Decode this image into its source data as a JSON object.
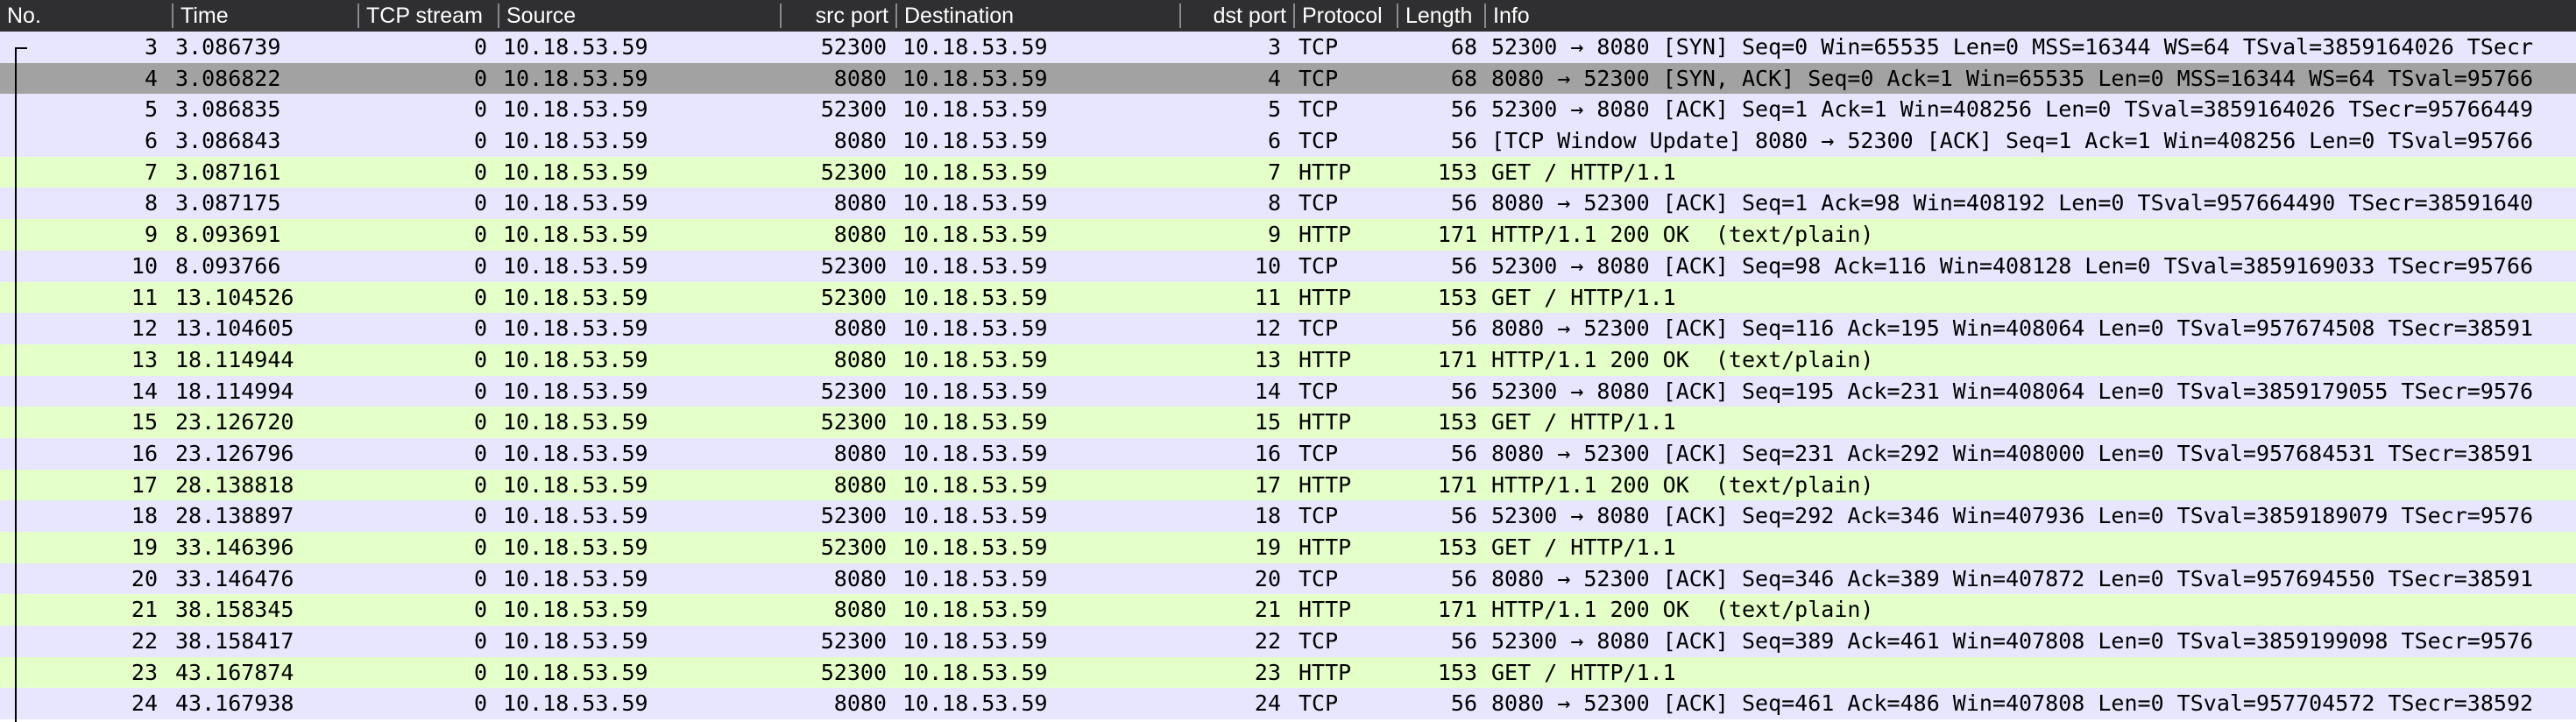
{
  "columns": {
    "no": "No.",
    "time": "Time",
    "tcp_stream": "TCP stream",
    "source": "Source",
    "src_port": "src port",
    "destination": "Destination",
    "dst_port": "dst port",
    "protocol": "Protocol",
    "length": "Length",
    "info": "Info"
  },
  "colors": {
    "header_bg": "#2f2f31",
    "tcp_row": "#e7e6fe",
    "http_row": "#e4ffc7",
    "selected_row": "#a2a2a2"
  },
  "selected_packet": "4",
  "packets": [
    {
      "no": "3",
      "time": "3.086739",
      "stream": "0",
      "src": "10.18.53.59",
      "sport": "52300",
      "dst": "10.18.53.59",
      "dport": "3",
      "proto": "TCP",
      "len": "68",
      "info": "52300 → 8080 [SYN] Seq=0 Win=65535 Len=0 MSS=16344 WS=64 TSval=3859164026 TSecr"
    },
    {
      "no": "4",
      "time": "3.086822",
      "stream": "0",
      "src": "10.18.53.59",
      "sport": "8080",
      "dst": "10.18.53.59",
      "dport": "4",
      "proto": "TCP",
      "len": "68",
      "info": "8080 → 52300 [SYN, ACK] Seq=0 Ack=1 Win=65535 Len=0 MSS=16344 WS=64 TSval=95766"
    },
    {
      "no": "5",
      "time": "3.086835",
      "stream": "0",
      "src": "10.18.53.59",
      "sport": "52300",
      "dst": "10.18.53.59",
      "dport": "5",
      "proto": "TCP",
      "len": "56",
      "info": "52300 → 8080 [ACK] Seq=1 Ack=1 Win=408256 Len=0 TSval=3859164026 TSecr=95766449"
    },
    {
      "no": "6",
      "time": "3.086843",
      "stream": "0",
      "src": "10.18.53.59",
      "sport": "8080",
      "dst": "10.18.53.59",
      "dport": "6",
      "proto": "TCP",
      "len": "56",
      "info": "[TCP Window Update] 8080 → 52300 [ACK] Seq=1 Ack=1 Win=408256 Len=0 TSval=95766"
    },
    {
      "no": "7",
      "time": "3.087161",
      "stream": "0",
      "src": "10.18.53.59",
      "sport": "52300",
      "dst": "10.18.53.59",
      "dport": "7",
      "proto": "HTTP",
      "len": "153",
      "info": "GET / HTTP/1.1"
    },
    {
      "no": "8",
      "time": "3.087175",
      "stream": "0",
      "src": "10.18.53.59",
      "sport": "8080",
      "dst": "10.18.53.59",
      "dport": "8",
      "proto": "TCP",
      "len": "56",
      "info": "8080 → 52300 [ACK] Seq=1 Ack=98 Win=408192 Len=0 TSval=957664490 TSecr=38591640"
    },
    {
      "no": "9",
      "time": "8.093691",
      "stream": "0",
      "src": "10.18.53.59",
      "sport": "8080",
      "dst": "10.18.53.59",
      "dport": "9",
      "proto": "HTTP",
      "len": "171",
      "info": "HTTP/1.1 200 OK  (text/plain)"
    },
    {
      "no": "10",
      "time": "8.093766",
      "stream": "0",
      "src": "10.18.53.59",
      "sport": "52300",
      "dst": "10.18.53.59",
      "dport": "10",
      "proto": "TCP",
      "len": "56",
      "info": "52300 → 8080 [ACK] Seq=98 Ack=116 Win=408128 Len=0 TSval=3859169033 TSecr=95766"
    },
    {
      "no": "11",
      "time": "13.104526",
      "stream": "0",
      "src": "10.18.53.59",
      "sport": "52300",
      "dst": "10.18.53.59",
      "dport": "11",
      "proto": "HTTP",
      "len": "153",
      "info": "GET / HTTP/1.1"
    },
    {
      "no": "12",
      "time": "13.104605",
      "stream": "0",
      "src": "10.18.53.59",
      "sport": "8080",
      "dst": "10.18.53.59",
      "dport": "12",
      "proto": "TCP",
      "len": "56",
      "info": "8080 → 52300 [ACK] Seq=116 Ack=195 Win=408064 Len=0 TSval=957674508 TSecr=38591"
    },
    {
      "no": "13",
      "time": "18.114944",
      "stream": "0",
      "src": "10.18.53.59",
      "sport": "8080",
      "dst": "10.18.53.59",
      "dport": "13",
      "proto": "HTTP",
      "len": "171",
      "info": "HTTP/1.1 200 OK  (text/plain)"
    },
    {
      "no": "14",
      "time": "18.114994",
      "stream": "0",
      "src": "10.18.53.59",
      "sport": "52300",
      "dst": "10.18.53.59",
      "dport": "14",
      "proto": "TCP",
      "len": "56",
      "info": "52300 → 8080 [ACK] Seq=195 Ack=231 Win=408064 Len=0 TSval=3859179055 TSecr=9576"
    },
    {
      "no": "15",
      "time": "23.126720",
      "stream": "0",
      "src": "10.18.53.59",
      "sport": "52300",
      "dst": "10.18.53.59",
      "dport": "15",
      "proto": "HTTP",
      "len": "153",
      "info": "GET / HTTP/1.1"
    },
    {
      "no": "16",
      "time": "23.126796",
      "stream": "0",
      "src": "10.18.53.59",
      "sport": "8080",
      "dst": "10.18.53.59",
      "dport": "16",
      "proto": "TCP",
      "len": "56",
      "info": "8080 → 52300 [ACK] Seq=231 Ack=292 Win=408000 Len=0 TSval=957684531 TSecr=38591"
    },
    {
      "no": "17",
      "time": "28.138818",
      "stream": "0",
      "src": "10.18.53.59",
      "sport": "8080",
      "dst": "10.18.53.59",
      "dport": "17",
      "proto": "HTTP",
      "len": "171",
      "info": "HTTP/1.1 200 OK  (text/plain)"
    },
    {
      "no": "18",
      "time": "28.138897",
      "stream": "0",
      "src": "10.18.53.59",
      "sport": "52300",
      "dst": "10.18.53.59",
      "dport": "18",
      "proto": "TCP",
      "len": "56",
      "info": "52300 → 8080 [ACK] Seq=292 Ack=346 Win=407936 Len=0 TSval=3859189079 TSecr=9576"
    },
    {
      "no": "19",
      "time": "33.146396",
      "stream": "0",
      "src": "10.18.53.59",
      "sport": "52300",
      "dst": "10.18.53.59",
      "dport": "19",
      "proto": "HTTP",
      "len": "153",
      "info": "GET / HTTP/1.1"
    },
    {
      "no": "20",
      "time": "33.146476",
      "stream": "0",
      "src": "10.18.53.59",
      "sport": "8080",
      "dst": "10.18.53.59",
      "dport": "20",
      "proto": "TCP",
      "len": "56",
      "info": "8080 → 52300 [ACK] Seq=346 Ack=389 Win=407872 Len=0 TSval=957694550 TSecr=38591"
    },
    {
      "no": "21",
      "time": "38.158345",
      "stream": "0",
      "src": "10.18.53.59",
      "sport": "8080",
      "dst": "10.18.53.59",
      "dport": "21",
      "proto": "HTTP",
      "len": "171",
      "info": "HTTP/1.1 200 OK  (text/plain)"
    },
    {
      "no": "22",
      "time": "38.158417",
      "stream": "0",
      "src": "10.18.53.59",
      "sport": "52300",
      "dst": "10.18.53.59",
      "dport": "22",
      "proto": "TCP",
      "len": "56",
      "info": "52300 → 8080 [ACK] Seq=389 Ack=461 Win=407808 Len=0 TSval=3859199098 TSecr=9576"
    },
    {
      "no": "23",
      "time": "43.167874",
      "stream": "0",
      "src": "10.18.53.59",
      "sport": "52300",
      "dst": "10.18.53.59",
      "dport": "23",
      "proto": "HTTP",
      "len": "153",
      "info": "GET / HTTP/1.1"
    },
    {
      "no": "24",
      "time": "43.167938",
      "stream": "0",
      "src": "10.18.53.59",
      "sport": "8080",
      "dst": "10.18.53.59",
      "dport": "24",
      "proto": "TCP",
      "len": "56",
      "info": "8080 → 52300 [ACK] Seq=461 Ack=486 Win=407808 Len=0 TSval=957704572 TSecr=38592"
    }
  ]
}
